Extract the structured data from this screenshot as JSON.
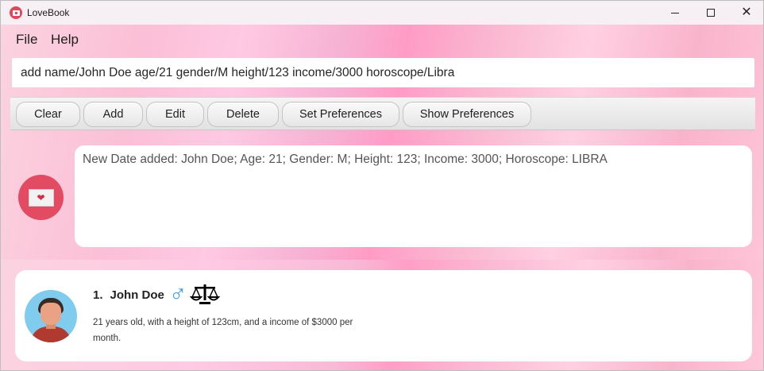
{
  "window": {
    "title": "LoveBook"
  },
  "menu": {
    "file": "File",
    "help": "Help"
  },
  "command": {
    "value": "add name/John Doe age/21 gender/M height/123 income/3000 horoscope/Libra"
  },
  "buttons": {
    "clear": "Clear",
    "add": "Add",
    "edit": "Edit",
    "delete": "Delete",
    "set_preferences": "Set Preferences",
    "show_preferences": "Show Preferences"
  },
  "result": {
    "text": "New Date added: John Doe; Age: 21; Gender: M; Height: 123; Income: 3000; Horoscope: LIBRA"
  },
  "list": {
    "items": [
      {
        "index": "1.",
        "name": "John Doe",
        "gender_symbol": "♂",
        "horoscope_icon": "libra-scales-icon",
        "description": "21 years old, with a height of 123cm, and a income of $3000 per month."
      }
    ]
  },
  "colors": {
    "accent": "#e24b61",
    "gender_male": "#3aa0de",
    "background_pink": "#ffc9e3"
  }
}
